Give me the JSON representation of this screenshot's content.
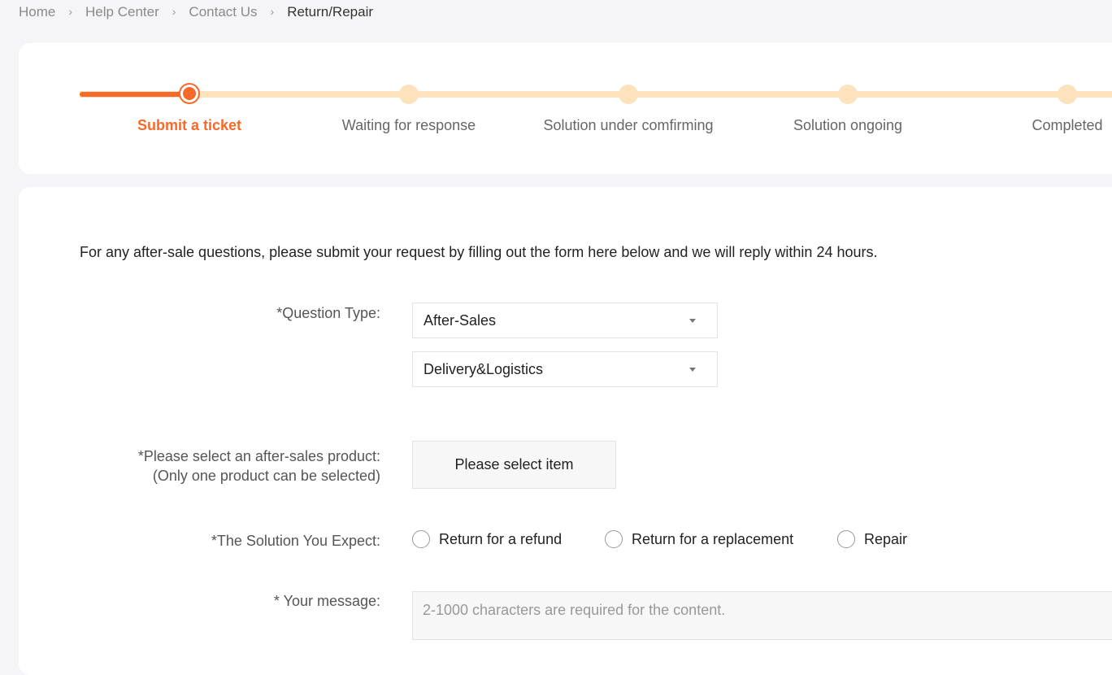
{
  "breadcrumb": {
    "items": [
      "Home",
      "Help Center",
      "Contact Us",
      "Return/Repair"
    ]
  },
  "steps": {
    "items": [
      {
        "label": "Submit a ticket",
        "active": true
      },
      {
        "label": "Waiting for response",
        "active": false
      },
      {
        "label": "Solution under comfirming",
        "active": false
      },
      {
        "label": "Solution ongoing",
        "active": false
      },
      {
        "label": "Completed",
        "active": false
      }
    ],
    "colors": {
      "active": "#f5692a",
      "inactive": "#fde3bd"
    }
  },
  "form": {
    "intro": "For any after-sale questions, please submit your request by filling out the form here below and we will reply within 24 hours.",
    "question_type": {
      "label": "*Question Type:",
      "select1_value": "After-Sales",
      "select2_value": "Delivery&Logistics"
    },
    "product": {
      "label_line1": "*Please select an after-sales product:",
      "label_line2": "(Only one product can be selected)",
      "button_label": "Please select item"
    },
    "solution": {
      "label": "*The Solution You Expect:",
      "options": [
        "Return for a refund",
        "Return for a replacement",
        "Repair"
      ]
    },
    "message": {
      "label": "* Your message:",
      "placeholder": "2-1000 characters are required for the content."
    }
  }
}
